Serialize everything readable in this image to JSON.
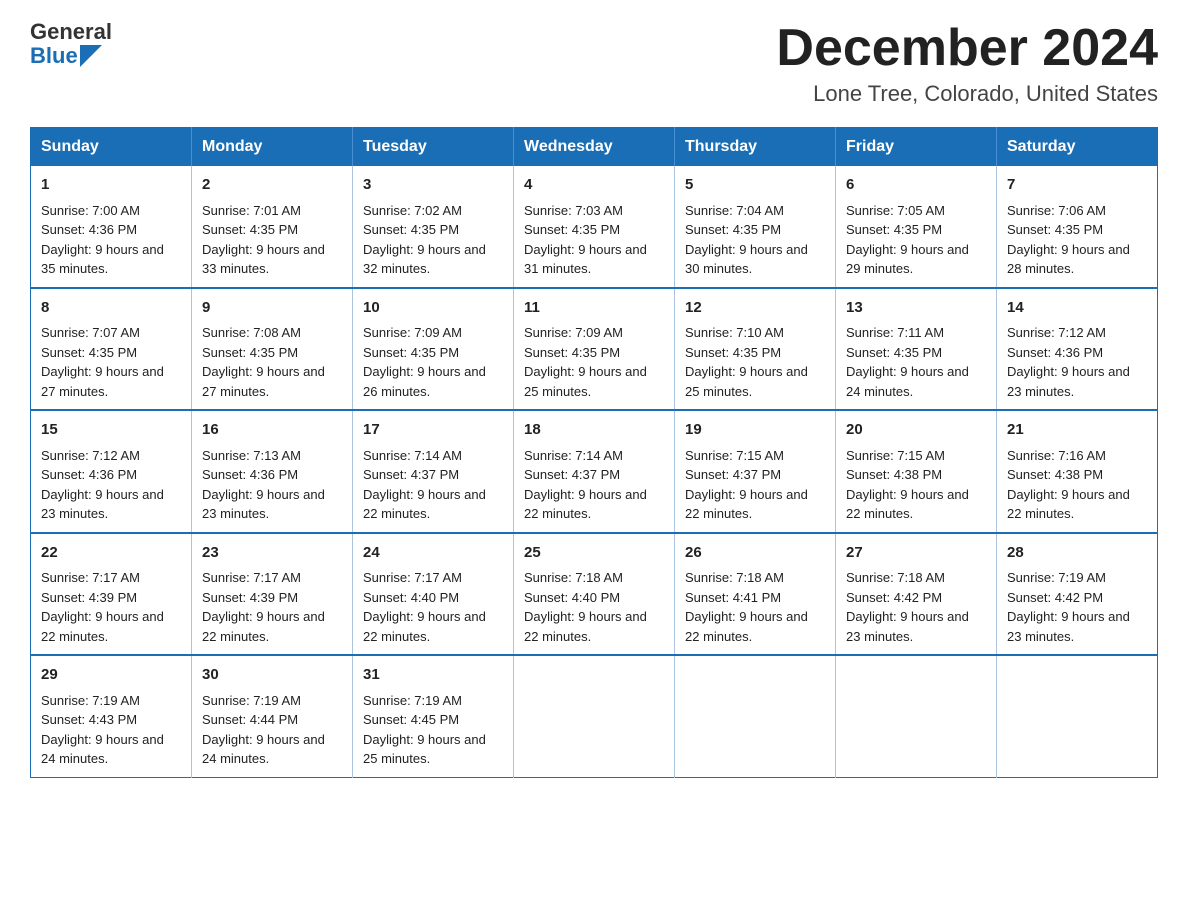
{
  "logo": {
    "general": "General",
    "blue": "Blue"
  },
  "title": "December 2024",
  "subtitle": "Lone Tree, Colorado, United States",
  "days_of_week": [
    "Sunday",
    "Monday",
    "Tuesday",
    "Wednesday",
    "Thursday",
    "Friday",
    "Saturday"
  ],
  "weeks": [
    [
      {
        "day": "1",
        "sunrise": "7:00 AM",
        "sunset": "4:36 PM",
        "daylight": "9 hours and 35 minutes."
      },
      {
        "day": "2",
        "sunrise": "7:01 AM",
        "sunset": "4:35 PM",
        "daylight": "9 hours and 33 minutes."
      },
      {
        "day": "3",
        "sunrise": "7:02 AM",
        "sunset": "4:35 PM",
        "daylight": "9 hours and 32 minutes."
      },
      {
        "day": "4",
        "sunrise": "7:03 AM",
        "sunset": "4:35 PM",
        "daylight": "9 hours and 31 minutes."
      },
      {
        "day": "5",
        "sunrise": "7:04 AM",
        "sunset": "4:35 PM",
        "daylight": "9 hours and 30 minutes."
      },
      {
        "day": "6",
        "sunrise": "7:05 AM",
        "sunset": "4:35 PM",
        "daylight": "9 hours and 29 minutes."
      },
      {
        "day": "7",
        "sunrise": "7:06 AM",
        "sunset": "4:35 PM",
        "daylight": "9 hours and 28 minutes."
      }
    ],
    [
      {
        "day": "8",
        "sunrise": "7:07 AM",
        "sunset": "4:35 PM",
        "daylight": "9 hours and 27 minutes."
      },
      {
        "day": "9",
        "sunrise": "7:08 AM",
        "sunset": "4:35 PM",
        "daylight": "9 hours and 27 minutes."
      },
      {
        "day": "10",
        "sunrise": "7:09 AM",
        "sunset": "4:35 PM",
        "daylight": "9 hours and 26 minutes."
      },
      {
        "day": "11",
        "sunrise": "7:09 AM",
        "sunset": "4:35 PM",
        "daylight": "9 hours and 25 minutes."
      },
      {
        "day": "12",
        "sunrise": "7:10 AM",
        "sunset": "4:35 PM",
        "daylight": "9 hours and 25 minutes."
      },
      {
        "day": "13",
        "sunrise": "7:11 AM",
        "sunset": "4:35 PM",
        "daylight": "9 hours and 24 minutes."
      },
      {
        "day": "14",
        "sunrise": "7:12 AM",
        "sunset": "4:36 PM",
        "daylight": "9 hours and 23 minutes."
      }
    ],
    [
      {
        "day": "15",
        "sunrise": "7:12 AM",
        "sunset": "4:36 PM",
        "daylight": "9 hours and 23 minutes."
      },
      {
        "day": "16",
        "sunrise": "7:13 AM",
        "sunset": "4:36 PM",
        "daylight": "9 hours and 23 minutes."
      },
      {
        "day": "17",
        "sunrise": "7:14 AM",
        "sunset": "4:37 PM",
        "daylight": "9 hours and 22 minutes."
      },
      {
        "day": "18",
        "sunrise": "7:14 AM",
        "sunset": "4:37 PM",
        "daylight": "9 hours and 22 minutes."
      },
      {
        "day": "19",
        "sunrise": "7:15 AM",
        "sunset": "4:37 PM",
        "daylight": "9 hours and 22 minutes."
      },
      {
        "day": "20",
        "sunrise": "7:15 AM",
        "sunset": "4:38 PM",
        "daylight": "9 hours and 22 minutes."
      },
      {
        "day": "21",
        "sunrise": "7:16 AM",
        "sunset": "4:38 PM",
        "daylight": "9 hours and 22 minutes."
      }
    ],
    [
      {
        "day": "22",
        "sunrise": "7:17 AM",
        "sunset": "4:39 PM",
        "daylight": "9 hours and 22 minutes."
      },
      {
        "day": "23",
        "sunrise": "7:17 AM",
        "sunset": "4:39 PM",
        "daylight": "9 hours and 22 minutes."
      },
      {
        "day": "24",
        "sunrise": "7:17 AM",
        "sunset": "4:40 PM",
        "daylight": "9 hours and 22 minutes."
      },
      {
        "day": "25",
        "sunrise": "7:18 AM",
        "sunset": "4:40 PM",
        "daylight": "9 hours and 22 minutes."
      },
      {
        "day": "26",
        "sunrise": "7:18 AM",
        "sunset": "4:41 PM",
        "daylight": "9 hours and 22 minutes."
      },
      {
        "day": "27",
        "sunrise": "7:18 AM",
        "sunset": "4:42 PM",
        "daylight": "9 hours and 23 minutes."
      },
      {
        "day": "28",
        "sunrise": "7:19 AM",
        "sunset": "4:42 PM",
        "daylight": "9 hours and 23 minutes."
      }
    ],
    [
      {
        "day": "29",
        "sunrise": "7:19 AM",
        "sunset": "4:43 PM",
        "daylight": "9 hours and 24 minutes."
      },
      {
        "day": "30",
        "sunrise": "7:19 AM",
        "sunset": "4:44 PM",
        "daylight": "9 hours and 24 minutes."
      },
      {
        "day": "31",
        "sunrise": "7:19 AM",
        "sunset": "4:45 PM",
        "daylight": "9 hours and 25 minutes."
      },
      null,
      null,
      null,
      null
    ]
  ]
}
